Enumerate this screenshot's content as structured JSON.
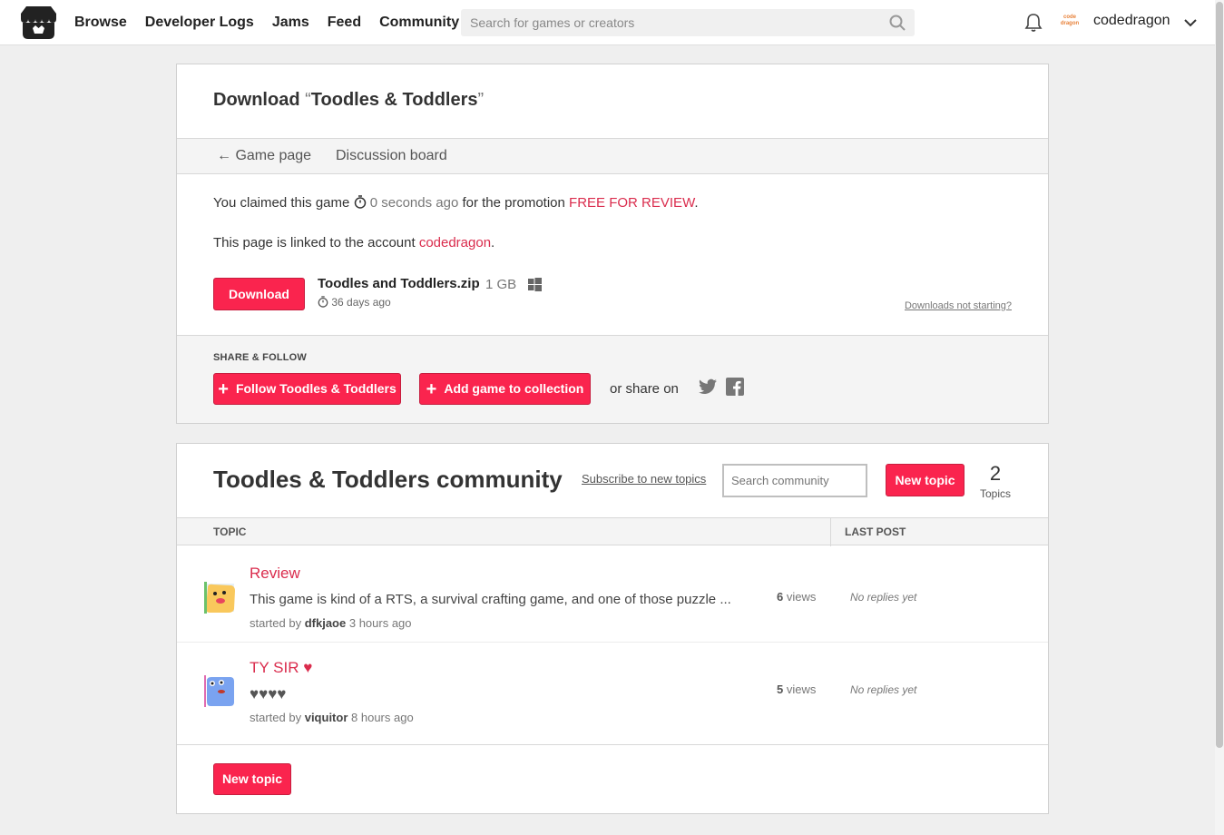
{
  "header": {
    "nav": [
      "Browse",
      "Developer Logs",
      "Jams",
      "Feed",
      "Community"
    ],
    "search_placeholder": "Search for games or creators",
    "avatar_text": "code dragon",
    "username": "codedragon"
  },
  "download": {
    "title_prefix": "Download",
    "open_quote": "“",
    "game_name": "Toodles & Toddlers",
    "close_quote": "”",
    "back_link": "← Game page",
    "discussion_link": "Discussion board",
    "claimed_prefix": "You claimed this game",
    "claimed_time": "0 seconds ago",
    "claimed_mid": "for the promotion",
    "promotion": "FREE FOR REVIEW",
    "linked_prefix": "This page is linked to the account",
    "linked_account": "codedragon",
    "download_button": "Download",
    "file_name": "Toodles and Toddlers.zip",
    "file_size": "1 GB",
    "file_date": "36 days ago",
    "downloads_help": "Downloads not starting?"
  },
  "share": {
    "label": "SHARE & FOLLOW",
    "follow_button": "Follow Toodles & Toddlers",
    "collection_button": "Add game to collection",
    "share_on": "or share on"
  },
  "community": {
    "title": "Toodles & Toddlers community",
    "subscribe": "Subscribe to new topics",
    "search_placeholder": "Search community",
    "new_topic": "New topic",
    "topics_count": "2",
    "topics_label": "Topics",
    "col_topic": "TOPIC",
    "col_last_post": "LAST POST",
    "topics": [
      {
        "title": "Review",
        "excerpt": "This game is kind of a RTS, a survival crafting game, and one of those puzzle ...",
        "started_by": "started by",
        "author": "dfkjaoe",
        "time": "3 hours ago",
        "views_count": "6",
        "views_label": "views",
        "last_post": "No replies yet"
      },
      {
        "title": "TY SIR ♥",
        "excerpt": "♥♥♥♥",
        "started_by": "started by",
        "author": "viquitor",
        "time": "8 hours ago",
        "views_count": "5",
        "views_label": "views",
        "last_post": "No replies yet"
      }
    ],
    "new_topic_bottom": "New topic"
  },
  "colors": {
    "accent": "#fa244e",
    "link": "#da2c4d"
  }
}
